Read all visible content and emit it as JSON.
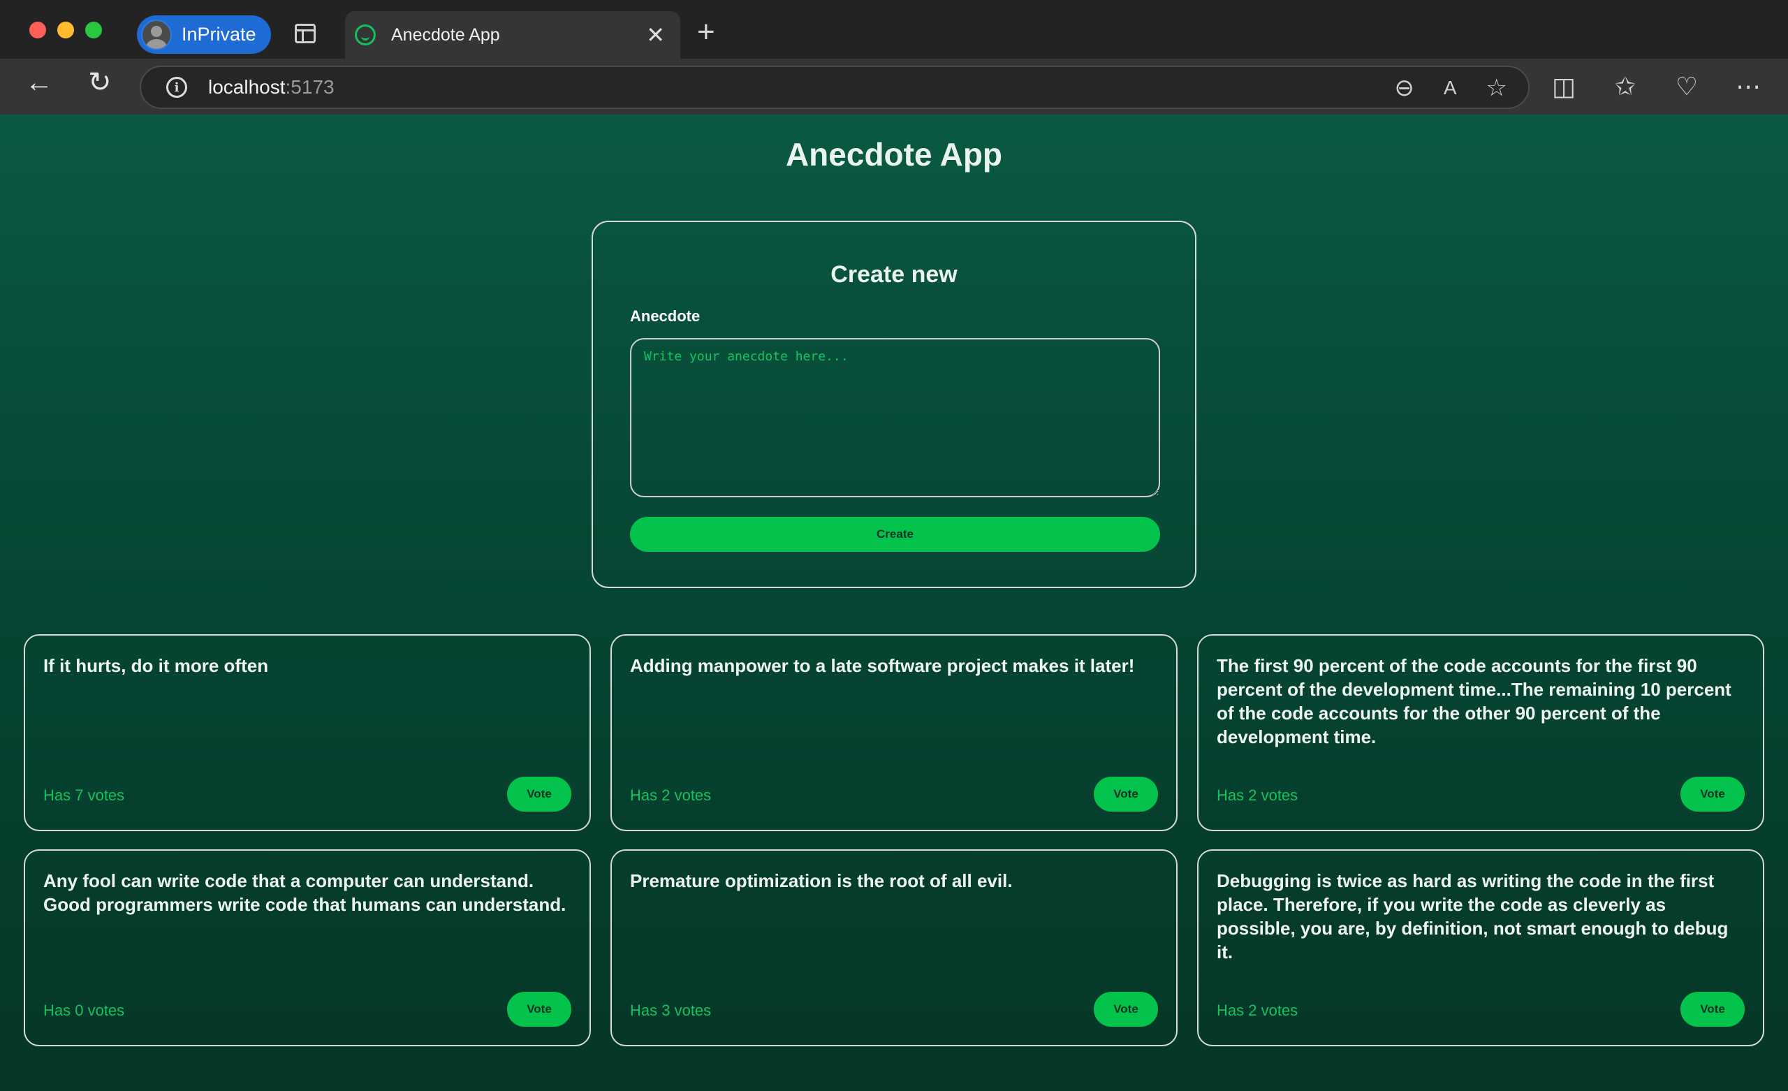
{
  "browser": {
    "profile_label": "InPrivate",
    "tab_title": "Anecdote App",
    "tab_close": "✕",
    "new_tab": "+",
    "url_host": "localhost",
    "url_port": ":5173",
    "info_glyph": "i",
    "icons": [
      "zoom-out-icon",
      "read-aloud-icon",
      "favorite-star-icon",
      "split-screen-icon",
      "favorites-icon",
      "browser-health-icon",
      "more-icon"
    ]
  },
  "app": {
    "title": "Anecdote App",
    "create": {
      "title": "Create new",
      "field_label": "Anecdote",
      "placeholder": "Write your anecdote here...",
      "button": "Create"
    },
    "anecdotes": [
      {
        "content": "If it hurts, do it more often",
        "votes": "Has 7 votes",
        "button": "Vote"
      },
      {
        "content": "Adding manpower to a late software project makes it later!",
        "votes": "Has 2 votes",
        "button": "Vote"
      },
      {
        "content": "The first 90 percent of the code accounts for the first 90 percent of the development time...The remaining 10 percent of the code accounts for the other 90 percent of the development time.",
        "votes": "Has 2 votes",
        "button": "Vote"
      },
      {
        "content": "Any fool can write code that a computer can understand. Good programmers write code that humans can understand.",
        "votes": "Has 0 votes",
        "button": "Vote"
      },
      {
        "content": "Premature optimization is the root of all evil.",
        "votes": "Has 3 votes",
        "button": "Vote"
      },
      {
        "content": "Debugging is twice as hard as writing the code in the first place. Therefore, if you write the code as cleverly as possible, you are, by definition, not smart enough to debug it.",
        "votes": "Has 2 votes",
        "button": "Vote"
      }
    ]
  },
  "colors": {
    "accent": "#04c34d",
    "background_top": "#0a5a43",
    "background_bottom": "#053627",
    "votes_text": "#17c25c"
  }
}
